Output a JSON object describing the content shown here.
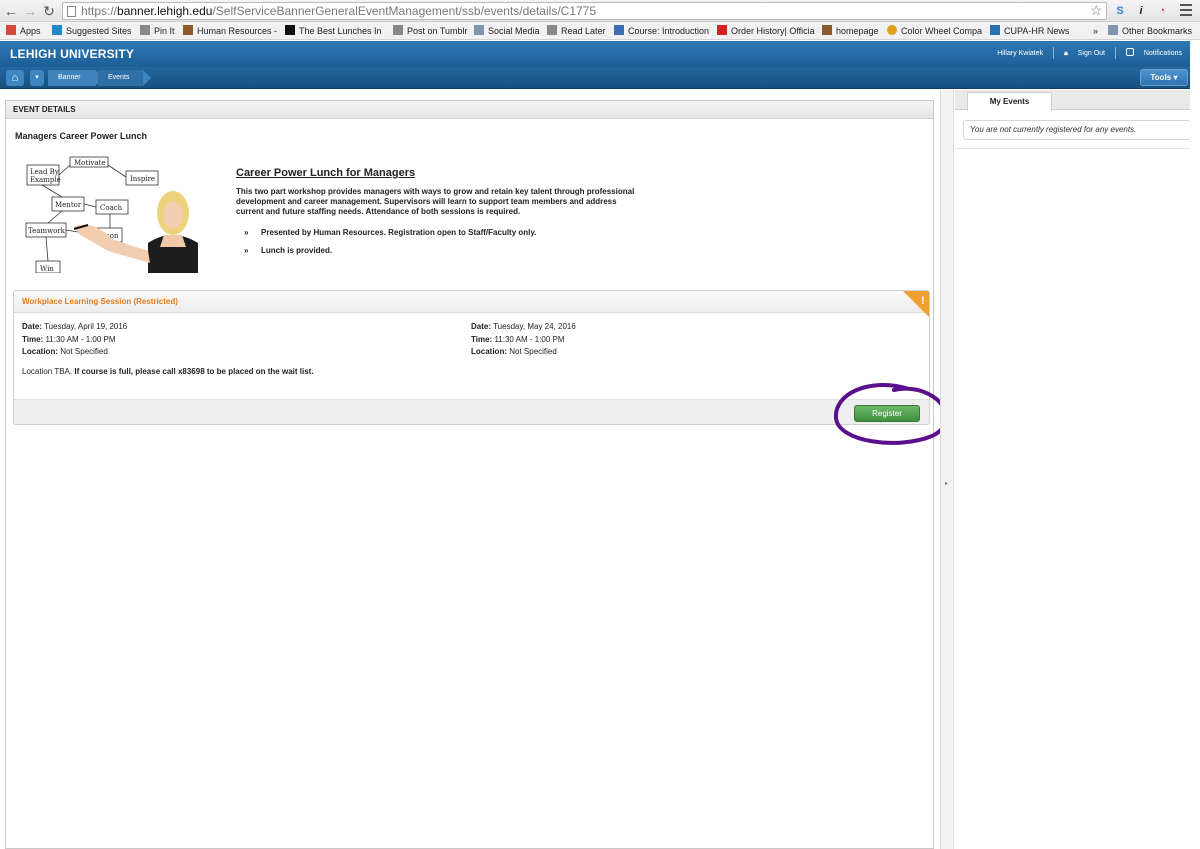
{
  "browser": {
    "url_scheme": "https://",
    "url_host": "banner.lehigh.edu",
    "url_path": "/SelfServiceBannerGeneralEventManagement/ssb/events/details/C1775",
    "extensions": [
      {
        "glyph": "S",
        "color": "#2f7ee0"
      },
      {
        "glyph": "i",
        "color": "#222222"
      },
      {
        "glyph": "◔",
        "color": "#d92fa6"
      }
    ]
  },
  "bookmarks": {
    "items": [
      {
        "label": "Apps",
        "icon": "apps-grid-icon",
        "color": "#d24a3b"
      },
      {
        "label": "Suggested Sites",
        "icon": "bing-icon",
        "color": "#1e88c8"
      },
      {
        "label": "Pin It",
        "icon": "page-icon",
        "color": "#888888"
      },
      {
        "label": "Human Resources -",
        "icon": "lehigh-shield-icon",
        "color": "#8a5a2b"
      },
      {
        "label": "The Best Lunches In",
        "icon": "lm-logo-icon",
        "color": "#111111"
      },
      {
        "label": "Post on Tumblr",
        "icon": "page-icon",
        "color": "#888888"
      },
      {
        "label": "Social Media",
        "icon": "folder-icon",
        "color": "#7f95ad"
      },
      {
        "label": "Read Later",
        "icon": "page-icon",
        "color": "#888888"
      },
      {
        "label": "Course: Introduction",
        "icon": "course-icon",
        "color": "#3b6fb5"
      },
      {
        "label": "Order History| Officia",
        "icon": "y-logo-icon",
        "color": "#d42323"
      },
      {
        "label": "homepage",
        "icon": "lehigh-shield-icon",
        "color": "#8a5a2b"
      },
      {
        "label": "Color Wheel Compa",
        "icon": "color-wheel-icon",
        "color": "#e0a020"
      },
      {
        "label": "CUPA-HR News",
        "icon": "cupa-icon",
        "color": "#2a6fb0"
      }
    ],
    "overflow": "»",
    "other_label": "Other Bookmarks"
  },
  "header": {
    "brand": "LEHIGH UNIVERSITY",
    "user_name": "Hillary Kwiatek",
    "sign_out": "Sign Out",
    "notifications": "Notifications"
  },
  "nav": {
    "breadcrumbs": [
      "Banner",
      "Events"
    ],
    "tools_label": "Tools ▾"
  },
  "main": {
    "panel_title": "EVENT DETAILS",
    "event_title": "Managers Career Power Lunch",
    "image_words": [
      "Motivate",
      "Lead By",
      "Example",
      "Inspire",
      "Mentor",
      "Coach",
      "Teamwork",
      "Vison",
      "Win"
    ],
    "desc_title": "Career Power Lunch for Managers",
    "desc_lines": [
      "This two part workshop provides managers with ways to grow and retain key talent through professional",
      "development and career management. Supervisors will learn to support team members and address",
      "current and future staffing needs. Attendance of both sessions is required."
    ],
    "bullet_symbol": "»",
    "bullets": [
      "Presented by Human Resources. Registration open to Staff/Faculty only.",
      "Lunch is provided."
    ]
  },
  "session": {
    "title": "Workplace Learning Session (Restricted)",
    "flag_glyph": "!",
    "date_label": "Date:",
    "time_label": "Time:",
    "location_label": "Location:",
    "dates": [
      {
        "date": "Tuesday, April 19, 2016",
        "time": "11:30 AM - 1:00 PM",
        "location": "Not Specified"
      },
      {
        "date": "Tuesday, May 24, 2016",
        "time": "11:30 AM - 1:00 PM",
        "location": "Not Specified"
      }
    ],
    "note_plain": "Location TBA.",
    "note_bold": "If course is full, please call x83698 to be placed on the wait list.",
    "register_label": "Register",
    "annotation_color": "#5a0f8c"
  },
  "side": {
    "tab_label": "My Events",
    "empty_message": "You are not currently registered for any events."
  }
}
